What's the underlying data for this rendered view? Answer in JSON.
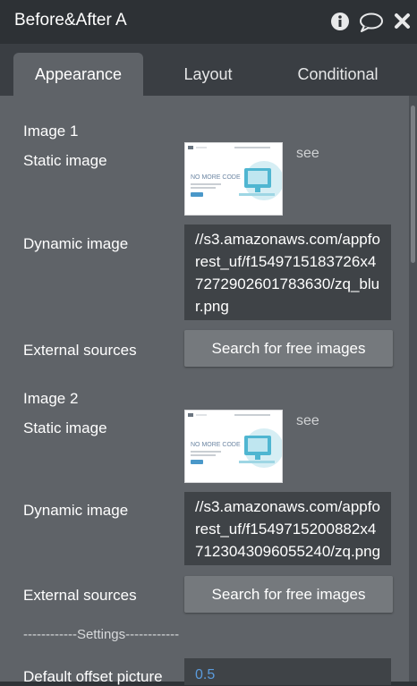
{
  "title": "Before&After A",
  "icons": [
    "info-icon",
    "comment-icon",
    "close-icon"
  ],
  "tabs": [
    {
      "label": "Appearance",
      "active": true
    },
    {
      "label": "Layout",
      "active": false
    },
    {
      "label": "Conditional",
      "active": false
    }
  ],
  "image1": {
    "heading": "Image 1",
    "static_label": "Static image",
    "see": "see",
    "dynamic_label": "Dynamic image",
    "dynamic_value": "//s3.amazonaws.com/appforest_uf/f1549715183726x47272902601783630/zq_blur.png",
    "external_label": "External sources",
    "external_button": "Search for free images",
    "thumb_text": "NO MORE CODE"
  },
  "image2": {
    "heading": "Image 2",
    "static_label": "Static image",
    "see": "see",
    "dynamic_label": "Dynamic image",
    "dynamic_value": "//s3.amazonaws.com/appforest_uf/f1549715200882x47123043096055240/zq.png",
    "external_label": "External sources",
    "external_button": "Search for free images",
    "thumb_text": "NO MORE CODE"
  },
  "settings_divider": "------------Settings------------",
  "offset": {
    "label": "Default offset picture",
    "value": "0.5"
  },
  "colors": {
    "panel": "#5f6368",
    "header": "#2d3135",
    "input": "#3f4347",
    "button": "#75797d",
    "accent_value": "#5b9bdc"
  }
}
